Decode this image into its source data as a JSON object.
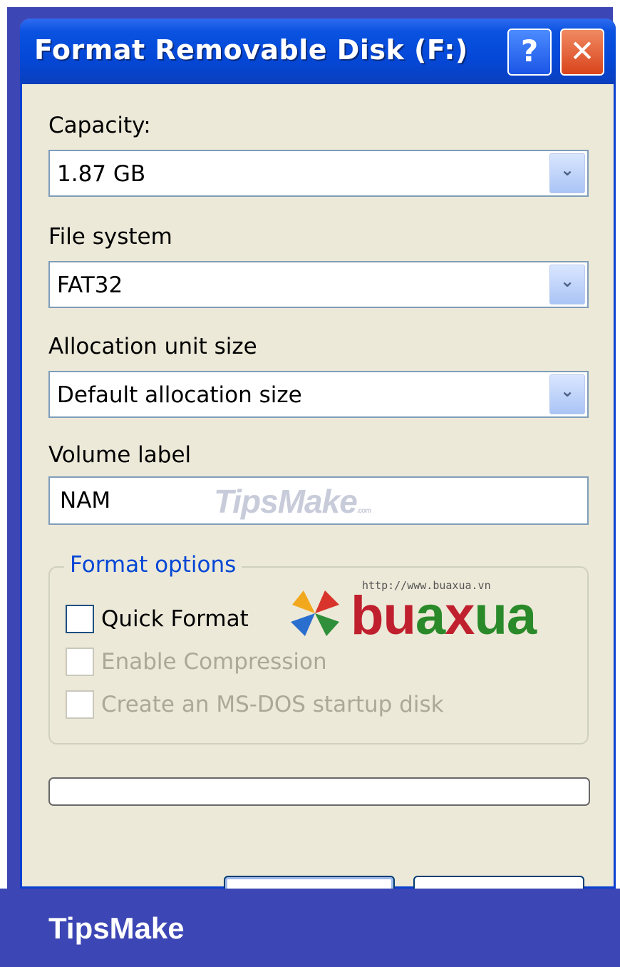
{
  "window": {
    "title": "Format Removable Disk (F:)",
    "help_glyph": "?",
    "close_glyph": "✕"
  },
  "capacity": {
    "label": "Capacity:",
    "value": "1.87 GB"
  },
  "file_system": {
    "label": "File system",
    "value": "FAT32"
  },
  "allocation": {
    "label": "Allocation unit size",
    "value": "Default allocation size"
  },
  "volume": {
    "label": "Volume label",
    "value": "NAM"
  },
  "format_options": {
    "title": "Format options",
    "quick_format": {
      "label": "Quick Format",
      "checked": false,
      "enabled": true
    },
    "enable_compression": {
      "label": "Enable Compression",
      "checked": false,
      "enabled": false
    },
    "msdos_startup": {
      "label": "Create an MS-DOS startup disk",
      "checked": false,
      "enabled": false
    }
  },
  "progress": {
    "value": 0
  },
  "watermark": {
    "text": "TipsMake",
    "suffix": ".com"
  },
  "logo": {
    "url": "http://www.buaxua.vn",
    "letters": [
      "b",
      "u",
      "a",
      "x",
      "u",
      "a"
    ],
    "letter_colors": [
      "#c0202e",
      "#c0202e",
      "#2a8a2a",
      "#c0202e",
      "#2a8a2a",
      "#2a8a2a"
    ]
  },
  "banner": {
    "text": "TipsMake"
  },
  "colors": {
    "titlebar": "#0a52e0",
    "dialog_bg": "#ece9d8",
    "banner_bg": "#3c46b4",
    "group_title": "#0046d5"
  }
}
